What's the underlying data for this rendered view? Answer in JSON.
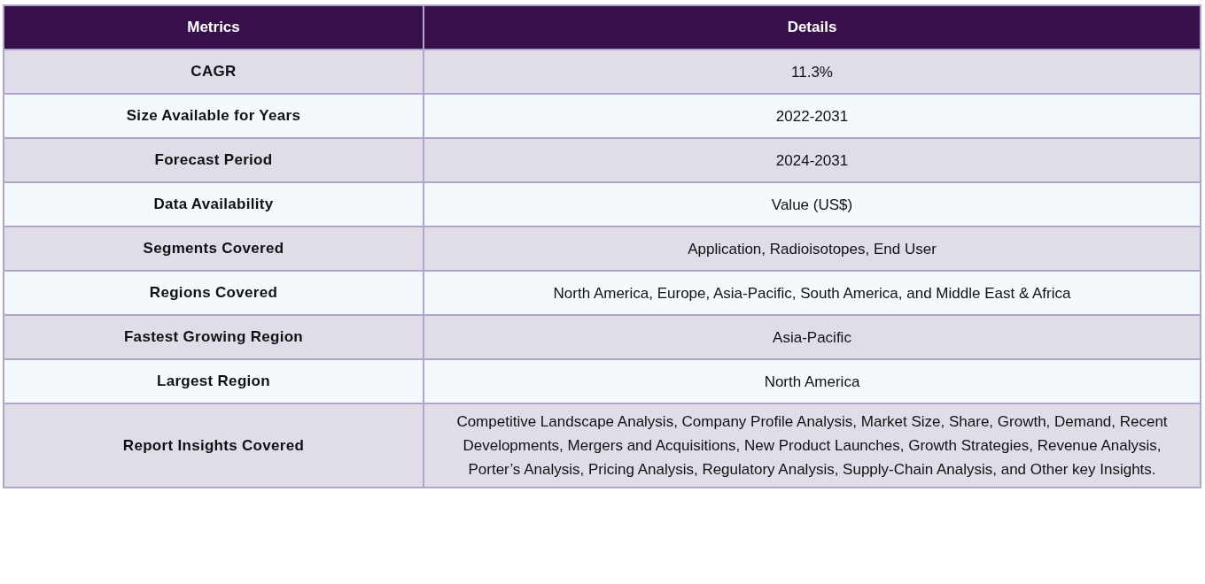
{
  "table": {
    "columns": [
      "Metrics",
      "Details"
    ],
    "rows": [
      {
        "metric": "CAGR",
        "detail": "11.3%"
      },
      {
        "metric": "Size Available for Years",
        "detail": "2022-2031"
      },
      {
        "metric": "Forecast Period",
        "detail": "2024-2031"
      },
      {
        "metric": "Data Availability",
        "detail": "Value (US$)"
      },
      {
        "metric": "Segments Covered",
        "detail": "Application, Radioisotopes, End User"
      },
      {
        "metric": "Regions Covered",
        "detail": "North America, Europe, Asia-Pacific, South America, and Middle East & Africa"
      },
      {
        "metric": "Fastest Growing Region",
        "detail": "Asia-Pacific"
      },
      {
        "metric": "Largest Region",
        "detail": "North America"
      },
      {
        "metric": "Report Insights Covered",
        "detail": "Competitive Landscape Analysis, Company Profile Analysis, Market Size, Share, Growth, Demand, Recent Developments, Mergers and Acquisitions, New Product Launches, Growth Strategies, Revenue Analysis, Porter’s Analysis, Pricing Analysis, Regulatory Analysis, Supply-Chain Analysis, and Other key Insights."
      }
    ]
  }
}
